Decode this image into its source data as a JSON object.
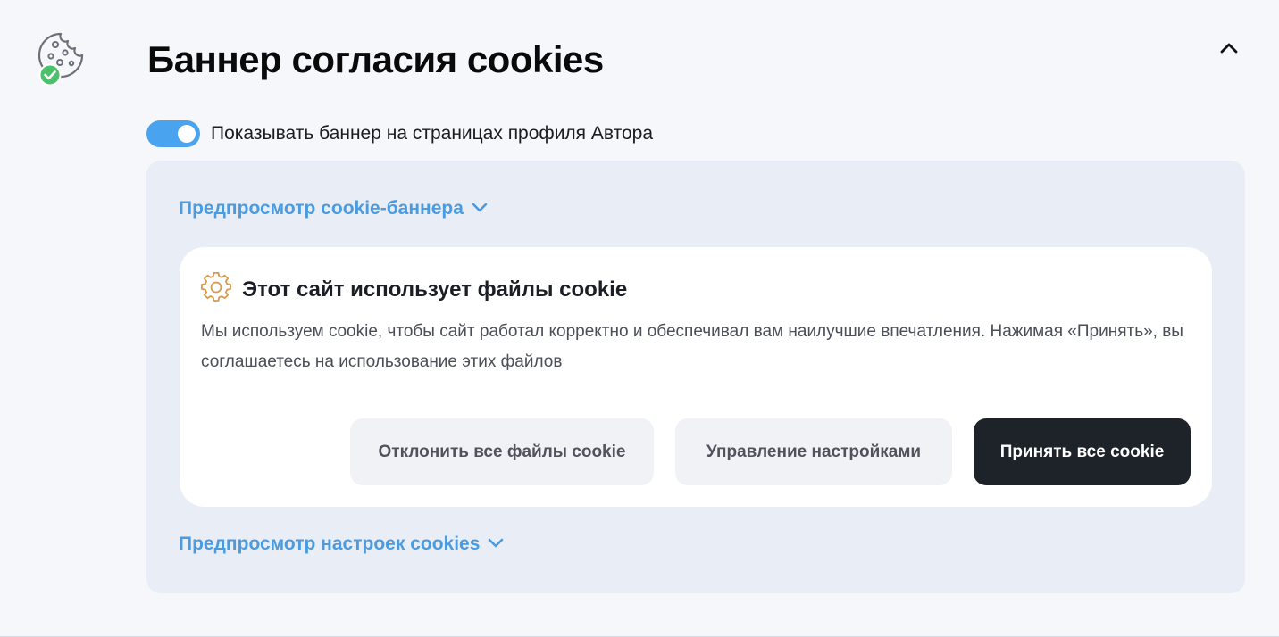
{
  "section": {
    "icon": "cookie-check-icon",
    "title": "Баннер согласия cookies",
    "collapse_icon": "chevron-up-icon"
  },
  "toggle": {
    "label": "Показывать баннер на страницах профиля Автора",
    "checked": true,
    "color": "#4aa3ee"
  },
  "preview": {
    "banner_link": "Предпросмотр cookie-баннера",
    "settings_link": "Предпросмотр настроек cookies",
    "link_color": "#4a9be0",
    "link_icon": "chevron-down-icon"
  },
  "banner": {
    "icon": "gear-icon",
    "title": "Этот сайт использует файлы cookie",
    "text": "Мы используем cookie, чтобы сайт работал корректно и обеспечивал вам наилучшие впечатления. Нажимая «Принять», вы соглашаетесь на использование этих файлов",
    "buttons": {
      "reject": "Отклонить все файлы cookie",
      "manage": "Управление настройками",
      "accept": "Принять все cookie"
    }
  }
}
